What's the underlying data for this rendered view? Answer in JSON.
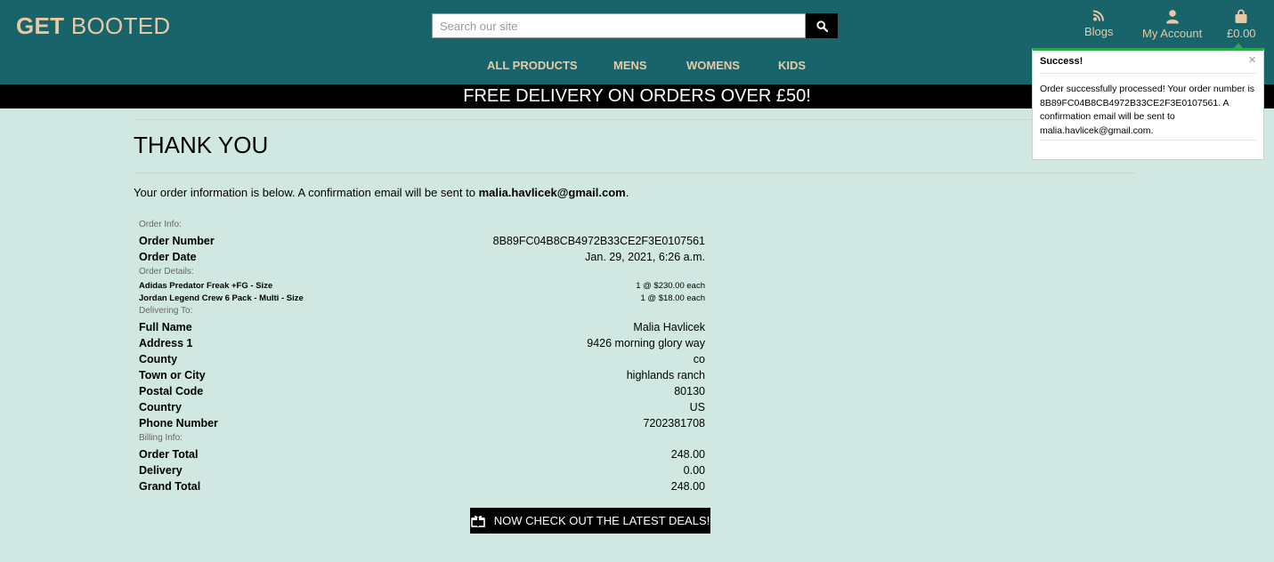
{
  "header": {
    "logo_bold": "GET",
    "logo_rest": "BOOTED",
    "search_placeholder": "Search our site",
    "links": {
      "blogs": "Blogs",
      "account": "My Account",
      "cart": "£0.00"
    }
  },
  "nav": [
    "ALL PRODUCTS",
    "MENS",
    "WOMENS",
    "KIDS"
  ],
  "banner": "FREE DELIVERY ON ORDERS OVER £50!",
  "page": {
    "title": "THANK YOU",
    "intro_prefix": "Your order information is below. A confirmation email will be sent to ",
    "email": "malia.havlicek@gmail.com",
    "intro_suffix": "."
  },
  "order": {
    "info_label": "Order Info:",
    "order_number_label": "Order Number",
    "order_number": "8B89FC04B8CB4972B33CE2F3E0107561",
    "order_date_label": "Order Date",
    "order_date": "Jan. 29, 2021, 6:26 a.m.",
    "details_label": "Order Details:",
    "items": [
      {
        "name": "Adidas Predator Freak +FG - Size",
        "qty": "1 @ $230.00 each"
      },
      {
        "name": "Jordan Legend Crew 6 Pack - Multi - Size",
        "qty": "1 @ $18.00 each"
      }
    ],
    "delivering_label": "Delivering To:",
    "delivery": [
      {
        "label": "Full Name",
        "value": "Malia Havlicek"
      },
      {
        "label": "Address 1",
        "value": "9426 morning glory way"
      },
      {
        "label": "County",
        "value": "co"
      },
      {
        "label": "Town or City",
        "value": "highlands ranch"
      },
      {
        "label": "Postal Code",
        "value": "80130"
      },
      {
        "label": "Country",
        "value": "US"
      },
      {
        "label": "Phone Number",
        "value": "7202381708"
      }
    ],
    "billing_label": "Billing Info:",
    "billing": [
      {
        "label": "Order Total",
        "value": "248.00"
      },
      {
        "label": "Delivery",
        "value": "0.00"
      },
      {
        "label": "Grand Total",
        "value": "248.00"
      }
    ]
  },
  "deals_button": "NOW CHECK OUT THE LATEST DEALS!",
  "toast": {
    "title": "Success!",
    "close": "×",
    "message": "Order successfully processed! Your order number is 8B89FC04B8CB4972B33CE2F3E0107561. A confirmation email will be sent to malia.havlicek@gmail.com."
  },
  "colors": {
    "header": "#18646a",
    "accent": "#e9c9a3",
    "background": "#d1e8e2",
    "success": "#2ea84f"
  }
}
